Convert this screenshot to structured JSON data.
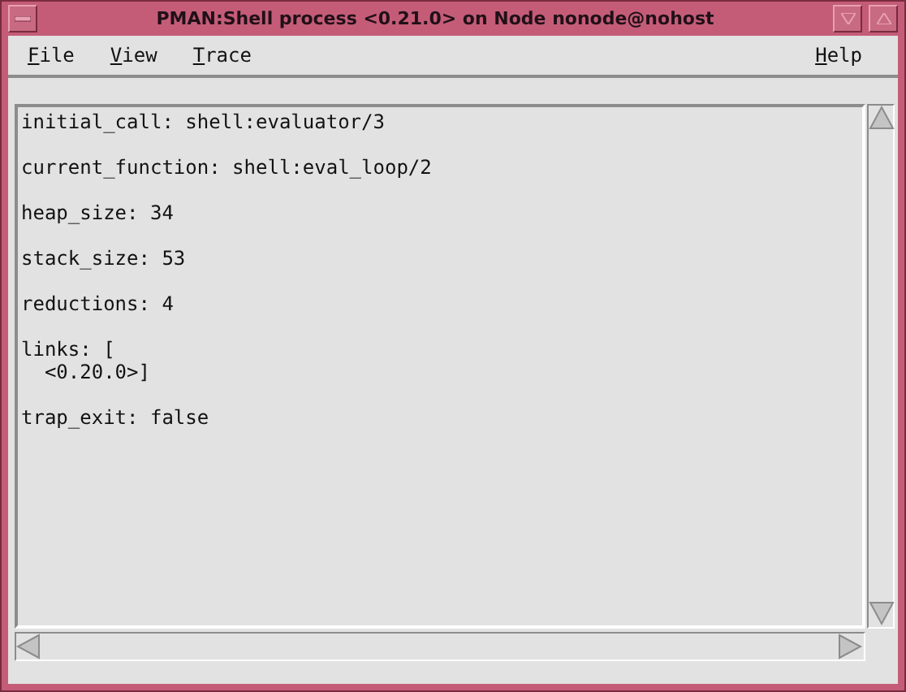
{
  "window": {
    "title": "PMAN:Shell process <0.21.0> on Node nonode@nohost"
  },
  "menu_left": [
    {
      "label": "File"
    },
    {
      "label": "View"
    },
    {
      "label": "Trace"
    }
  ],
  "menu_right": [
    {
      "label": "Help"
    }
  ],
  "info": [
    {
      "lines": [
        "initial_call: shell:evaluator/3"
      ]
    },
    {
      "lines": [
        "current_function: shell:eval_loop/2"
      ]
    },
    {
      "lines": [
        "heap_size: 34"
      ]
    },
    {
      "lines": [
        "stack_size: 53"
      ]
    },
    {
      "lines": [
        "reductions: 4"
      ]
    },
    {
      "lines": [
        "links: [",
        "  <0.20.0>]"
      ]
    },
    {
      "lines": [
        "trap_exit: false"
      ]
    }
  ]
}
